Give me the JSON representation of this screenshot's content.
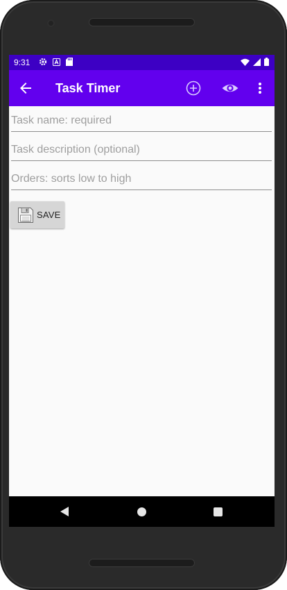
{
  "status_bar": {
    "time": "9:31",
    "left_icons": [
      "gear-icon",
      "a-badge-icon",
      "sd-card-icon"
    ],
    "right_icons": [
      "wifi-icon",
      "signal-icon",
      "battery-icon"
    ]
  },
  "app_bar": {
    "title": "Task Timer",
    "actions": [
      "add-circle-icon",
      "eye-icon",
      "more-vert-icon"
    ]
  },
  "form": {
    "name_placeholder": "Task name: required",
    "name_value": "",
    "description_placeholder": "Task description (optional)",
    "description_value": "",
    "order_placeholder": "Orders: sorts low to high",
    "order_value": "",
    "save_label": "SAVE"
  },
  "nav_bar": {
    "buttons": [
      "back-triangle-icon",
      "home-circle-icon",
      "recents-square-icon"
    ]
  },
  "colors": {
    "status_bar": "#3d00c4",
    "app_bar": "#6200ee",
    "background": "#fafafa",
    "hint_text": "#9e9e9e",
    "save_button": "#d6d6d6"
  }
}
